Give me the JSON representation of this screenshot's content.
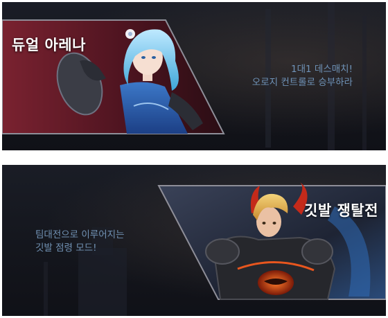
{
  "banners": [
    {
      "title": "듀얼 아레나",
      "description": [
        "1대1 데스매치!",
        "오로지 컨트롤로 승부하라"
      ],
      "accent_color": "#6e1a2a",
      "character_icon": "blue-haired-warrior-icon"
    },
    {
      "title": "깃발 쟁탈전",
      "description": [
        "팀대전으로 이루어지는",
        "깃발 점령 모드!"
      ],
      "accent_color": "#2a3a55",
      "character_icon": "armored-knight-icon"
    }
  ]
}
